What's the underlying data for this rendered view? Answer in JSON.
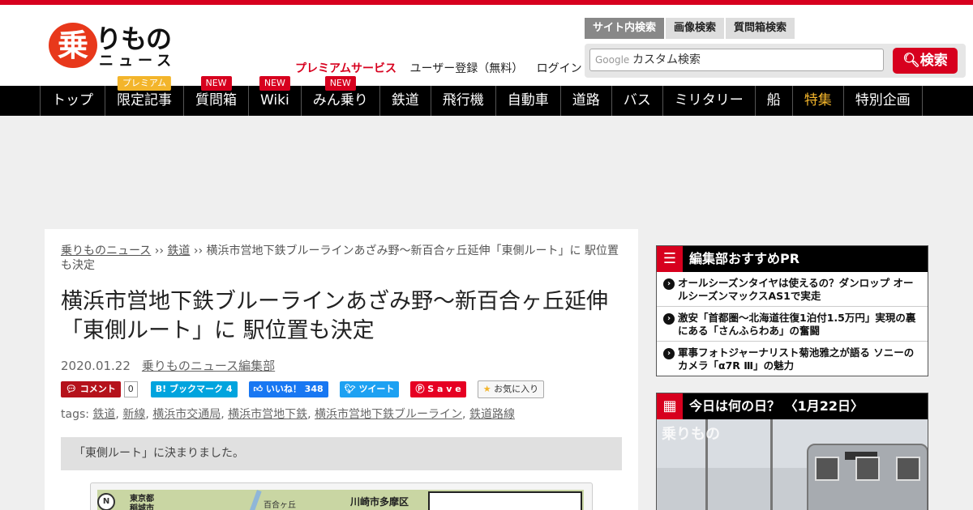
{
  "header": {
    "logo_kanji": "乗",
    "logo_kana": "りもの",
    "logo_sub": "ニュース",
    "links": {
      "premium": "プレミアムサービス",
      "register": "ユーザー登録（無料）",
      "login": "ログイン"
    },
    "search_tabs": [
      "サイト内検索",
      "画像検索",
      "質問箱検索"
    ],
    "search_placeholder": "カスタム検索",
    "google_label": "Google",
    "search_button": "検索"
  },
  "nav": [
    {
      "label": "トップ",
      "badge": ""
    },
    {
      "label": "限定記事",
      "badge": "プレミアム"
    },
    {
      "label": "質問箱",
      "badge": "NEW"
    },
    {
      "label": "Wiki",
      "badge": "NEW"
    },
    {
      "label": "みん乗り",
      "badge": "NEW"
    },
    {
      "label": "鉄道",
      "badge": ""
    },
    {
      "label": "飛行機",
      "badge": ""
    },
    {
      "label": "自動車",
      "badge": ""
    },
    {
      "label": "道路",
      "badge": ""
    },
    {
      "label": "バス",
      "badge": ""
    },
    {
      "label": "ミリタリー",
      "badge": ""
    },
    {
      "label": "船",
      "badge": ""
    },
    {
      "label": "特集",
      "badge": ""
    },
    {
      "label": "特別企画",
      "badge": ""
    }
  ],
  "article": {
    "breadcrumb": {
      "home": "乗りものニュース",
      "sep": " ›› ",
      "category": "鉄道",
      "current": "横浜市営地下鉄ブルーラインあざみ野～新百合ヶ丘延伸「東側ルート」に 駅位置も決定"
    },
    "title": "横浜市営地下鉄ブルーラインあざみ野～新百合ヶ丘延伸「東側ルート」に 駅位置も決定",
    "date": "2020.01.22",
    "author": "乗りものニュース編集部",
    "social": {
      "comment": "コメント",
      "comment_count": "0",
      "hatena": "B! ブックマーク  4",
      "facebook": "いいね！ 348",
      "twitter": "ツイート",
      "pinterest": "S a v e",
      "favorite": "お気に入り"
    },
    "tags_label": "tags: ",
    "tags": [
      "鉄道",
      "新線",
      "横浜市交通局",
      "横浜市営地下鉄",
      "横浜市営地下鉄ブルーライン",
      "鉄道路線"
    ],
    "lead": "「東側ルート」に決まりました。",
    "map_labels": {
      "a": "東京都",
      "b": "稲城市",
      "c": "百合ヶ丘",
      "d": "川崎市多摩区",
      "e": "N"
    }
  },
  "sidebar": {
    "pr_title": "編集部おすすめPR",
    "pr_items": [
      "オールシーズンタイヤは使えるの？ダンロップ オールシーズンマックスAS1で実走",
      "激安「首都圏～北海道往復1泊付1.5万円」実現の裏にある「さんふらわあ」の奮闘",
      "軍事フォトジャーナリスト菊池雅之が語る ソニーのカメラ「α7R Ⅲ」の魅力"
    ],
    "today_title": "今日は何の日？ 〈1月22日〉",
    "watermark": "乗りもの"
  },
  "colors": {
    "brand_red": "#d7001e",
    "nav_bg": "#000000",
    "special": "#f3b52b"
  }
}
